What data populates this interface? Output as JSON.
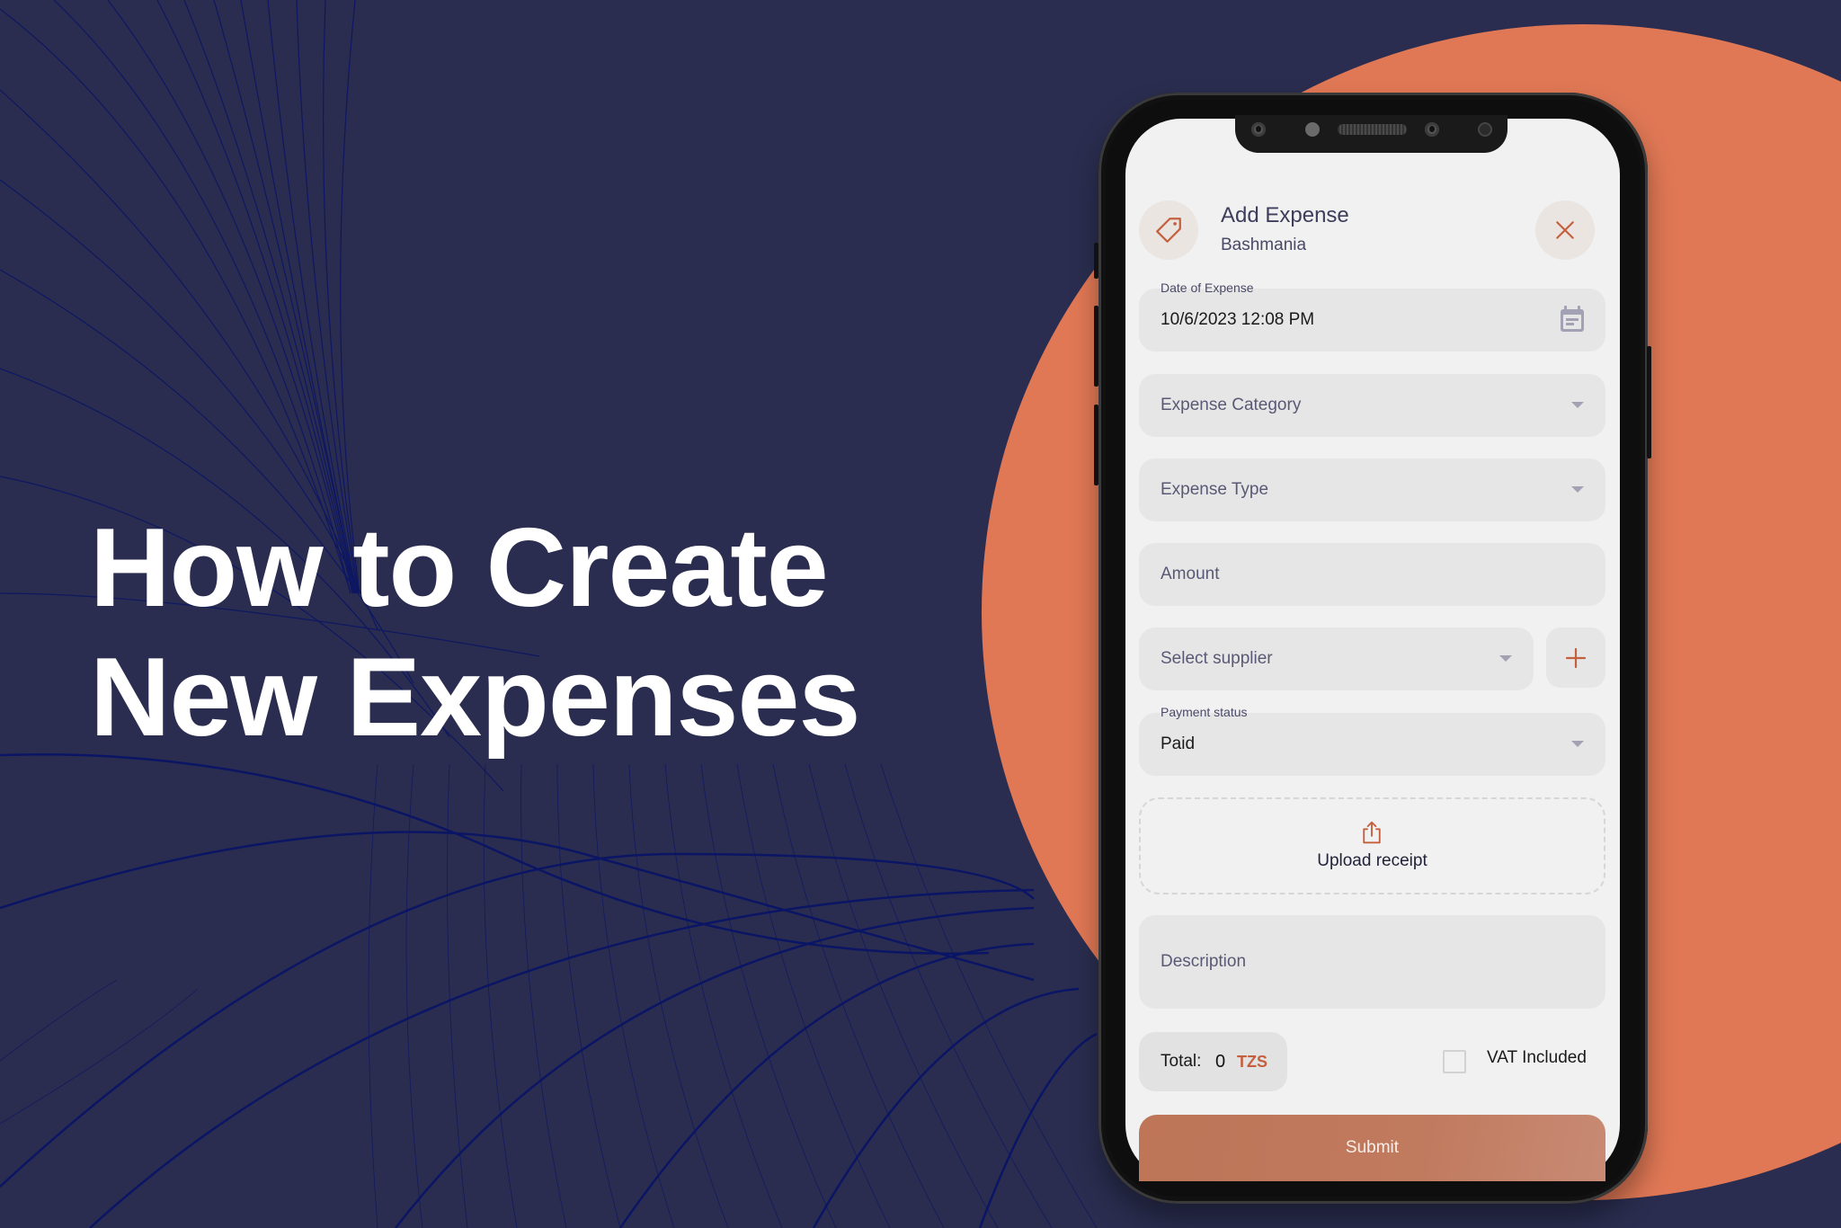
{
  "hero": {
    "line1": "How to Create",
    "line2": "New Expenses"
  },
  "colors": {
    "background": "#2a2d4f",
    "accent_orange": "#e07855",
    "brand_accent": "#c4603e",
    "submit": "#c07a5e"
  },
  "app": {
    "header": {
      "icon": "price-tag-icon",
      "title": "Add Expense",
      "subtitle": "Bashmania",
      "close_icon": "close-icon"
    },
    "form": {
      "date": {
        "label": "Date of Expense",
        "value": "10/6/2023 12:08 PM",
        "icon": "calendar-icon"
      },
      "category": {
        "placeholder": "Expense Category",
        "icon": "chevron-down-icon"
      },
      "type": {
        "placeholder": "Expense Type",
        "icon": "chevron-down-icon"
      },
      "amount": {
        "placeholder": "Amount"
      },
      "supplier": {
        "placeholder": "Select supplier",
        "icon": "chevron-down-icon",
        "add_icon": "plus-icon"
      },
      "payment_status": {
        "label": "Payment status",
        "value": "Paid",
        "icon": "chevron-down-icon"
      },
      "upload": {
        "label": "Upload receipt",
        "icon": "upload-icon"
      },
      "description": {
        "placeholder": "Description"
      }
    },
    "footer": {
      "total_label": "Total:",
      "total_value": "0",
      "currency": "TZS",
      "vat_label": "VAT Included",
      "vat_checked": false,
      "submit_label": "Submit"
    }
  }
}
